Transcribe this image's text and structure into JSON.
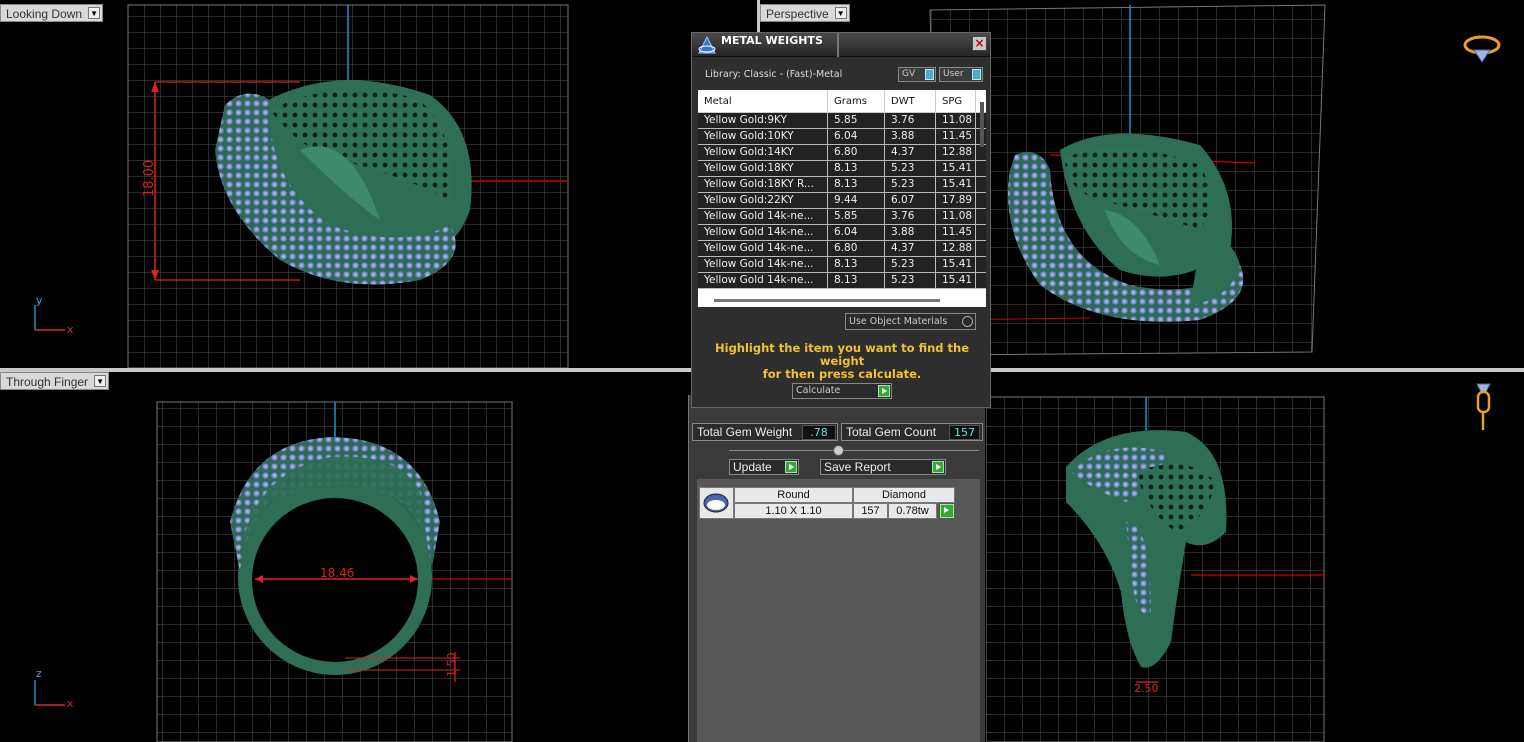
{
  "viewports": {
    "top_left": {
      "title": "Looking Down",
      "dimension": "18.00"
    },
    "top_right": {
      "title": "Perspective"
    },
    "bottom_left": {
      "title": "Through Finger",
      "dimension_width": "18.46",
      "dimension_height": "1.50"
    },
    "bottom_right": {
      "dimension": "2.50"
    }
  },
  "axes": {
    "y": "y",
    "x": "x",
    "z": "z"
  },
  "dialog": {
    "title": "METAL WEIGHTS",
    "library": "Library: Classic - (Fast)-Metal",
    "gv_label": "GV",
    "user_label": "User",
    "columns": [
      "Metal",
      "Grams",
      "DWT",
      "SPG"
    ],
    "rows": [
      [
        "Yellow Gold:9KY",
        "5.85",
        "3.76",
        "11.08"
      ],
      [
        "Yellow Gold:10KY",
        "6.04",
        "3.88",
        "11.45"
      ],
      [
        "Yellow Gold:14KY",
        "6.80",
        "4.37",
        "12.88"
      ],
      [
        "Yellow Gold:18KY",
        "8.13",
        "5.23",
        "15.41"
      ],
      [
        "Yellow Gold:18KY R...",
        "8.13",
        "5.23",
        "15.41"
      ],
      [
        "Yellow Gold:22KY",
        "9.44",
        "6.07",
        "17.89"
      ],
      [
        "Yellow Gold 14k-ne...",
        "5.85",
        "3.76",
        "11.08"
      ],
      [
        "Yellow Gold 14k-ne...",
        "6.04",
        "3.88",
        "11.45"
      ],
      [
        "Yellow Gold 14k-ne...",
        "6.80",
        "4.37",
        "12.88"
      ],
      [
        "Yellow Gold 14k-ne...",
        "8.13",
        "5.23",
        "15.41"
      ],
      [
        "Yellow Gold 14k-ne...",
        "8.13",
        "5.23",
        "15.41"
      ]
    ],
    "use_object_materials": "Use Object Materials",
    "hint_line1": "Highlight the item you want to find the weight",
    "hint_line2": "for then press calculate.",
    "calculate": "Calculate"
  },
  "gems": {
    "total_weight_label": "Total Gem Weight",
    "total_weight_value": ".78",
    "total_count_label": "Total Gem Count",
    "total_count_value": "157",
    "update": "Update",
    "save_report": "Save Report",
    "shape": "Round",
    "type": "Diamond",
    "size": "1.10 X 1.10",
    "count": "157",
    "weight": "0.78tw"
  },
  "colors": {
    "accent_green": "#3aa63a",
    "dimension_red": "#e02020",
    "ring_green": "#2e6e55",
    "gem_blue": "#8aa8d8",
    "hint_yellow": "#f1c232"
  }
}
